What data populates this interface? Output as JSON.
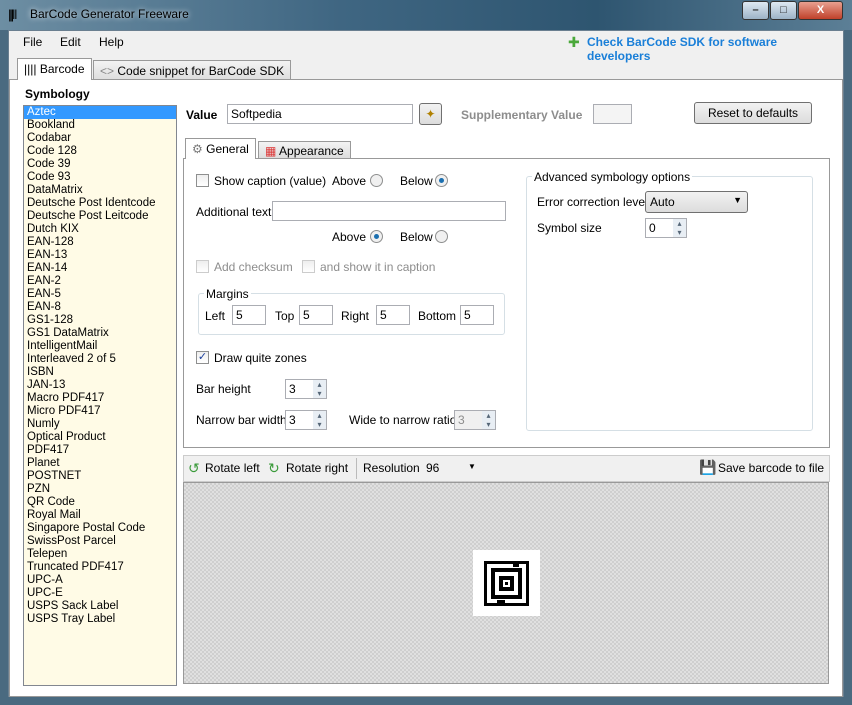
{
  "window": {
    "title": "BarCode Generator Freeware",
    "minimize": "–",
    "maximize": "□",
    "close": "X"
  },
  "menu": {
    "file": "File",
    "edit": "Edit",
    "help": "Help",
    "sdk_link": "Check BarCode SDK for software developers"
  },
  "tabs": {
    "barcode": "Barcode",
    "snippet": "Code snippet for BarCode SDK"
  },
  "symbology": {
    "label": "Symbology",
    "selected": "Aztec",
    "items": [
      "Aztec",
      "Bookland",
      "Codabar",
      "Code 128",
      "Code 39",
      "Code 93",
      "DataMatrix",
      "Deutsche Post Identcode",
      "Deutsche Post Leitcode",
      "Dutch KIX",
      "EAN-128",
      "EAN-13",
      "EAN-14",
      "EAN-2",
      "EAN-5",
      "EAN-8",
      "GS1-128",
      "GS1 DataMatrix",
      "IntelligentMail",
      "Interleaved 2 of 5",
      "ISBN",
      "JAN-13",
      "Macro PDF417",
      "Micro PDF417",
      "Numly",
      "Optical Product",
      "PDF417",
      "Planet",
      "POSTNET",
      "PZN",
      "QR Code",
      "Royal Mail",
      "Singapore Postal Code",
      "SwissPost Parcel",
      "Telepen",
      "Truncated PDF417",
      "UPC-A",
      "UPC-E",
      "USPS Sack Label",
      "USPS Tray Label"
    ]
  },
  "value": {
    "label": "Value",
    "value": "Softpedia",
    "supp_label": "Supplementary Value",
    "supp_value": "",
    "reset": "Reset to defaults"
  },
  "inner_tabs": {
    "general": "General",
    "appearance": "Appearance"
  },
  "general": {
    "show_caption": "Show caption (value)",
    "above": "Above",
    "below": "Below",
    "additional_text": "Additional text",
    "additional_value": "",
    "add_checksum": "Add checksum",
    "show_in_caption": "and show it in caption",
    "margins": "Margins",
    "left": "Left",
    "left_v": "5",
    "top": "Top",
    "top_v": "5",
    "right": "Right",
    "right_v": "5",
    "bottom": "Bottom",
    "bottom_v": "5",
    "quiet": "Draw quite zones",
    "bar_height": "Bar height",
    "bar_height_v": "3",
    "narrow": "Narrow bar width",
    "narrow_v": "3",
    "ratio": "Wide to narrow ratio",
    "ratio_v": "3"
  },
  "advanced": {
    "title": "Advanced symbology options",
    "ecl": "Error correction level",
    "ecl_v": "Auto",
    "size": "Symbol size",
    "size_v": "0"
  },
  "toolbar": {
    "rotate_left": "Rotate left",
    "rotate_right": "Rotate right",
    "resolution": "Resolution",
    "resolution_v": "96",
    "save": "Save barcode to file"
  }
}
